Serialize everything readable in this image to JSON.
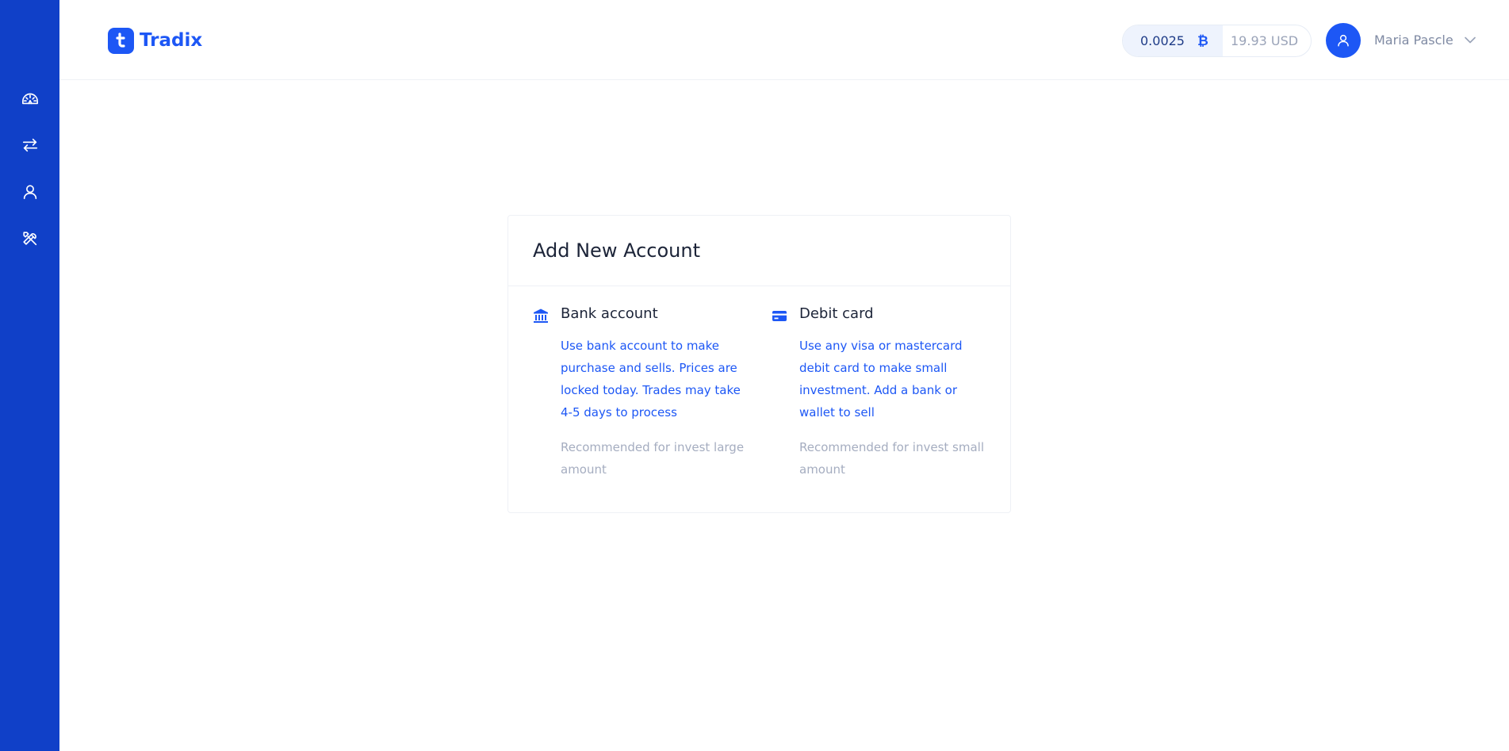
{
  "app": {
    "name": "Tradix"
  },
  "sidebar": {
    "items": [
      {
        "name": "dashboard",
        "icon": "dashboard-icon"
      },
      {
        "name": "exchange",
        "icon": "exchange-arrows-icon"
      },
      {
        "name": "account",
        "icon": "user-icon"
      },
      {
        "name": "settings",
        "icon": "tools-icon"
      }
    ]
  },
  "header": {
    "balance": {
      "crypto": "0.0025",
      "crypto_symbol": "₿",
      "usd": "19.93 USD"
    },
    "user": {
      "name": "Maria Pascle"
    }
  },
  "card": {
    "title": "Add New Account",
    "options": [
      {
        "icon": "bank-icon",
        "title": "Bank account",
        "description": "Use bank account to make purchase and sells. Prices are locked today. Trades may take 4-5 days to process",
        "recommendation": "Recommended for invest large amount"
      },
      {
        "icon": "credit-card-icon",
        "title": "Debit card",
        "description": "Use any visa or mastercard debit card to make small investment. Add a bank or wallet to sell",
        "recommendation": "Recommended for invest small amount"
      }
    ]
  },
  "colors": {
    "sidebar_bg": "#1040c8",
    "accent": "#1d57f5",
    "muted_text": "#a5adc0"
  }
}
